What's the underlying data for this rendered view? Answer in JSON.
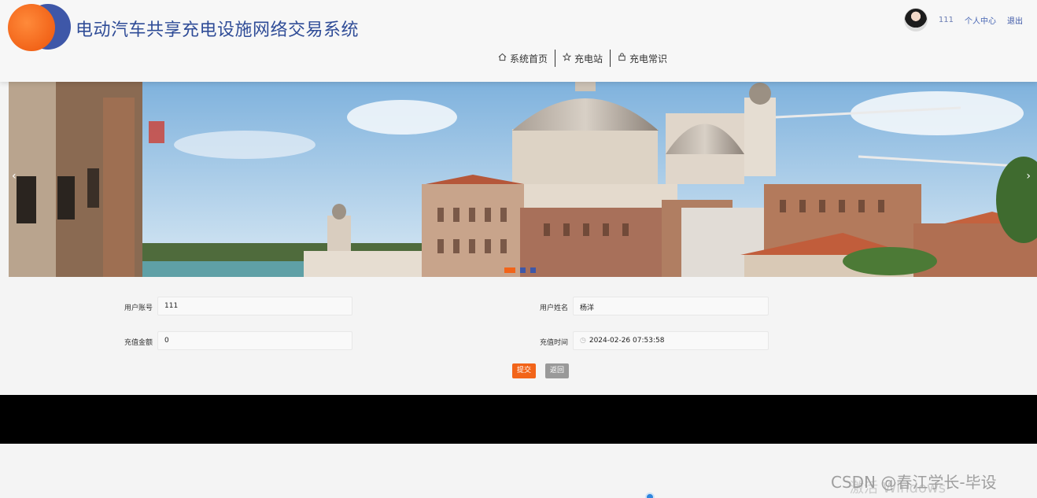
{
  "header": {
    "site_title": "电动汽车共享充电设施网络交易系统",
    "username": "111",
    "profile_link": "个人中心",
    "logout_link": "退出"
  },
  "nav": {
    "items": [
      {
        "label": "系统首页",
        "icon": "home-icon"
      },
      {
        "label": "充电站",
        "icon": "star-icon"
      },
      {
        "label": "充电常识",
        "icon": "bag-icon"
      }
    ]
  },
  "banner": {
    "arrow_left": "‹",
    "arrow_right": "›",
    "slide_count": 3,
    "active_slide": 1
  },
  "form": {
    "account_label": "用户账号",
    "account_value": "111",
    "name_label": "用户姓名",
    "name_value": "杨洋",
    "amount_label": "充值金额",
    "amount_value": "0",
    "time_label": "充值时间",
    "time_value": "2024-02-26 07:53:58",
    "submit_label": "提交",
    "back_label": "返回"
  },
  "overlay": {
    "watermark": "CSDN @春江学长-毕设",
    "windows_text": "激活 Windows"
  },
  "colors": {
    "brand_blue": "#2f4c97",
    "accent_orange": "#f26419",
    "back_gray": "#999999"
  }
}
